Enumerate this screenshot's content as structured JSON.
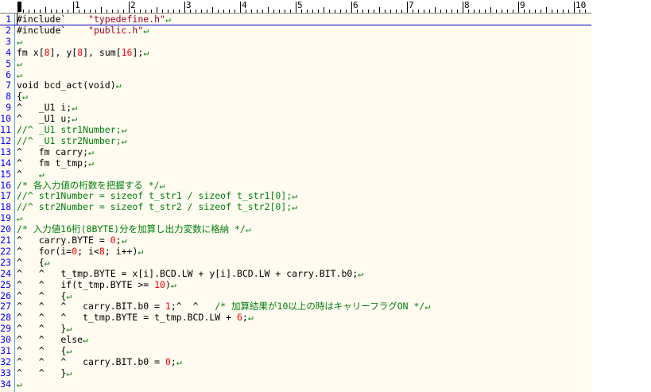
{
  "ruler": {
    "labels": [
      "1",
      "2",
      "3",
      "4",
      "5",
      "6",
      "7",
      "8",
      "9",
      "10"
    ]
  },
  "colors": {
    "line_number": "#0000ff",
    "string": "#a0002a",
    "number": "#ff0000",
    "comment": "#00800a",
    "background": "#fffbf0"
  },
  "lines": [
    {
      "n": "1",
      "segs": [
        [
          "#include`    ",
          ""
        ],
        [
          "\"typedefine.h\"",
          "str"
        ],
        [
          "↵",
          "cmt"
        ]
      ]
    },
    {
      "n": "2",
      "segs": [
        [
          "#include`    ",
          ""
        ],
        [
          "\"public.h\"",
          "str"
        ],
        [
          "↵",
          "cmt"
        ]
      ]
    },
    {
      "n": "3",
      "segs": [
        [
          "↵",
          "cmt"
        ]
      ]
    },
    {
      "n": "4",
      "segs": [
        [
          "fm x[",
          ""
        ],
        [
          "8",
          "num"
        ],
        [
          "], y[",
          ""
        ],
        [
          "8",
          "num"
        ],
        [
          "], sum[",
          ""
        ],
        [
          "16",
          "num"
        ],
        [
          "];",
          ""
        ],
        [
          "↵",
          "cmt"
        ]
      ]
    },
    {
      "n": "5",
      "segs": [
        [
          "↵",
          "cmt"
        ]
      ]
    },
    {
      "n": "6",
      "segs": [
        [
          "↵",
          "cmt"
        ]
      ]
    },
    {
      "n": "7",
      "segs": [
        [
          "void bcd_act(void)",
          ""
        ],
        [
          "↵",
          "cmt"
        ]
      ]
    },
    {
      "n": "8",
      "segs": [
        [
          "{",
          ""
        ],
        [
          "↵",
          "cmt"
        ]
      ]
    },
    {
      "n": "9",
      "segs": [
        [
          "^   _U1 i;",
          ""
        ],
        [
          "↵",
          "cmt"
        ]
      ]
    },
    {
      "n": "10",
      "segs": [
        [
          "^   _U1 u;",
          ""
        ],
        [
          "↵",
          "cmt"
        ]
      ]
    },
    {
      "n": "11",
      "segs": [
        [
          "//^ _U1 str1Number;",
          "cmt"
        ],
        [
          "↵",
          "cmt"
        ]
      ]
    },
    {
      "n": "12",
      "segs": [
        [
          "//^ _U1 str2Number;",
          "cmt"
        ],
        [
          "↵",
          "cmt"
        ]
      ]
    },
    {
      "n": "13",
      "segs": [
        [
          "^   fm carry;",
          ""
        ],
        [
          "↵",
          "cmt"
        ]
      ]
    },
    {
      "n": "14",
      "segs": [
        [
          "^   fm t_tmp;",
          ""
        ],
        [
          "↵",
          "cmt"
        ]
      ]
    },
    {
      "n": "15",
      "segs": [
        [
          "^   ",
          ""
        ],
        [
          "↵",
          "cmt"
        ]
      ]
    },
    {
      "n": "16",
      "segs": [
        [
          "/* 各入力値の桁数を把握する */",
          "cmt"
        ],
        [
          "↵",
          "cmt"
        ]
      ]
    },
    {
      "n": "17",
      "segs": [
        [
          "//^ str1Number = sizeof t_str1 / sizeof t_str1[0];",
          "cmt"
        ],
        [
          "↵",
          "cmt"
        ]
      ]
    },
    {
      "n": "18",
      "segs": [
        [
          "//^ str2Number = sizeof t_str2 / sizeof t_str2[0];",
          "cmt"
        ],
        [
          "↵",
          "cmt"
        ]
      ]
    },
    {
      "n": "19",
      "segs": [
        [
          "↵",
          "cmt"
        ]
      ]
    },
    {
      "n": "20",
      "segs": [
        [
          "/* 入力値16桁(8BYTE)分を加算し出力変数に格納 */",
          "cmt"
        ],
        [
          "↵",
          "cmt"
        ]
      ]
    },
    {
      "n": "21",
      "segs": [
        [
          "^   carry.BYTE = ",
          ""
        ],
        [
          "0",
          "num"
        ],
        [
          ";",
          ""
        ],
        [
          "↵",
          "cmt"
        ]
      ]
    },
    {
      "n": "22",
      "segs": [
        [
          "^   for(i=",
          ""
        ],
        [
          "0",
          "num"
        ],
        [
          "; i<",
          ""
        ],
        [
          "8",
          "num"
        ],
        [
          "; i++)",
          ""
        ],
        [
          "↵",
          "cmt"
        ]
      ]
    },
    {
      "n": "23",
      "segs": [
        [
          "^   {",
          ""
        ],
        [
          "↵",
          "cmt"
        ]
      ]
    },
    {
      "n": "24",
      "segs": [
        [
          "^   ^   t_tmp.BYTE = x[i].BCD.LW + y[i].BCD.LW + carry.BIT.b0;",
          ""
        ],
        [
          "↵",
          "cmt"
        ]
      ]
    },
    {
      "n": "25",
      "segs": [
        [
          "^   ^   if(t_tmp.BYTE >= ",
          ""
        ],
        [
          "10",
          "num"
        ],
        [
          ")",
          ""
        ],
        [
          "↵",
          "cmt"
        ]
      ]
    },
    {
      "n": "26",
      "segs": [
        [
          "^   ^   {",
          ""
        ],
        [
          "↵",
          "cmt"
        ]
      ]
    },
    {
      "n": "27",
      "segs": [
        [
          "^   ^   ^   carry.BIT.b0 = ",
          ""
        ],
        [
          "1",
          "num"
        ],
        [
          ";^  ^   ",
          ""
        ],
        [
          "/* 加算結果が10以上の時はキャリーフラグON */",
          "cmt"
        ],
        [
          "↵",
          "cmt"
        ]
      ]
    },
    {
      "n": "28",
      "segs": [
        [
          "^   ^   ^   t_tmp.BYTE = t_tmp.BCD.LW + ",
          ""
        ],
        [
          "6",
          "num"
        ],
        [
          ";",
          ""
        ],
        [
          "↵",
          "cmt"
        ]
      ]
    },
    {
      "n": "29",
      "segs": [
        [
          "^   ^   }",
          ""
        ],
        [
          "↵",
          "cmt"
        ]
      ]
    },
    {
      "n": "30",
      "segs": [
        [
          "^   ^   else",
          ""
        ],
        [
          "↵",
          "cmt"
        ]
      ]
    },
    {
      "n": "31",
      "segs": [
        [
          "^   ^   {",
          ""
        ],
        [
          "↵",
          "cmt"
        ]
      ]
    },
    {
      "n": "32",
      "segs": [
        [
          "^   ^   ^   carry.BIT.b0 = ",
          ""
        ],
        [
          "0",
          "num"
        ],
        [
          ";",
          ""
        ],
        [
          "↵",
          "cmt"
        ]
      ]
    },
    {
      "n": "33",
      "segs": [
        [
          "^   ^   }",
          ""
        ],
        [
          "↵",
          "cmt"
        ]
      ]
    },
    {
      "n": "34",
      "segs": [
        [
          "↵",
          "cmt"
        ]
      ]
    }
  ]
}
